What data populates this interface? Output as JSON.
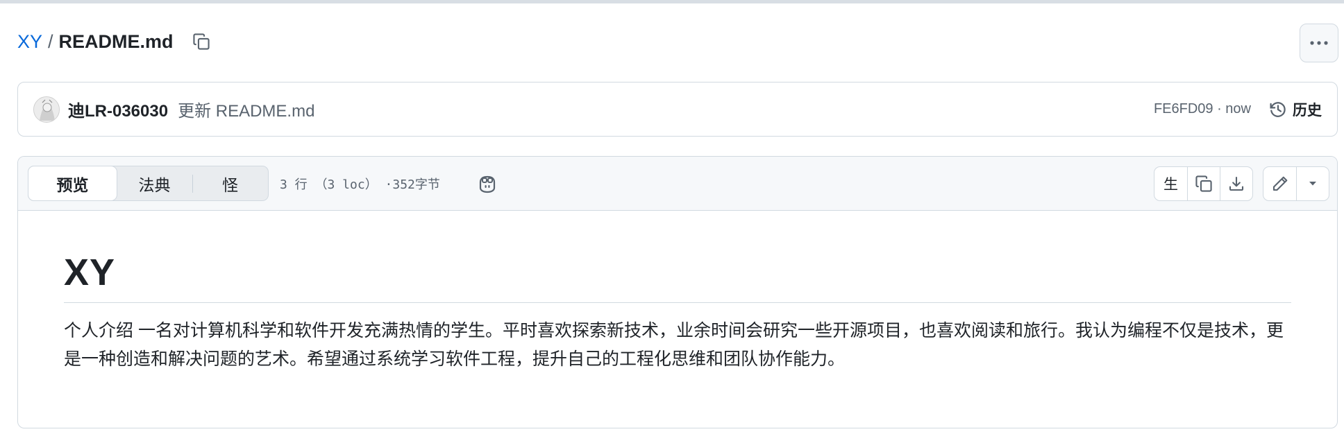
{
  "breadcrumb": {
    "repo": "XY",
    "separator": "/",
    "file": "README.md"
  },
  "commit": {
    "author": "迪LR-036030",
    "message": "更新 README.md",
    "sha_time": "FE6FD09 · now",
    "history_label": "历史"
  },
  "file_header": {
    "tabs": [
      {
        "label": "预览",
        "active": true
      },
      {
        "label": "法典",
        "active": false
      },
      {
        "label": "怪",
        "active": false
      }
    ],
    "meta": "3 行 （3 loc） ·352字节",
    "raw_label": "生"
  },
  "readme": {
    "heading": "XY",
    "paragraph": "个人介绍 一名对计算机科学和软件开发充满热情的学生。平时喜欢探索新技术，业余时间会研究一些开源项目，也喜欢阅读和旅行。我认为编程不仅是技术，更是一种创造和解决问题的艺术。希望通过系统学习软件工程，提升自己的工程化思维和团队协作能力。"
  },
  "icons": [
    "copy-icon",
    "kebab-horizontal-icon",
    "history-icon",
    "copilot-icon",
    "download-icon",
    "pencil-icon",
    "triangle-down-icon"
  ],
  "colors": {
    "link": "#0969da",
    "border": "#d1d9e0",
    "header_bg": "#f6f8fa",
    "text": "#1f2328",
    "muted": "#59636e"
  }
}
